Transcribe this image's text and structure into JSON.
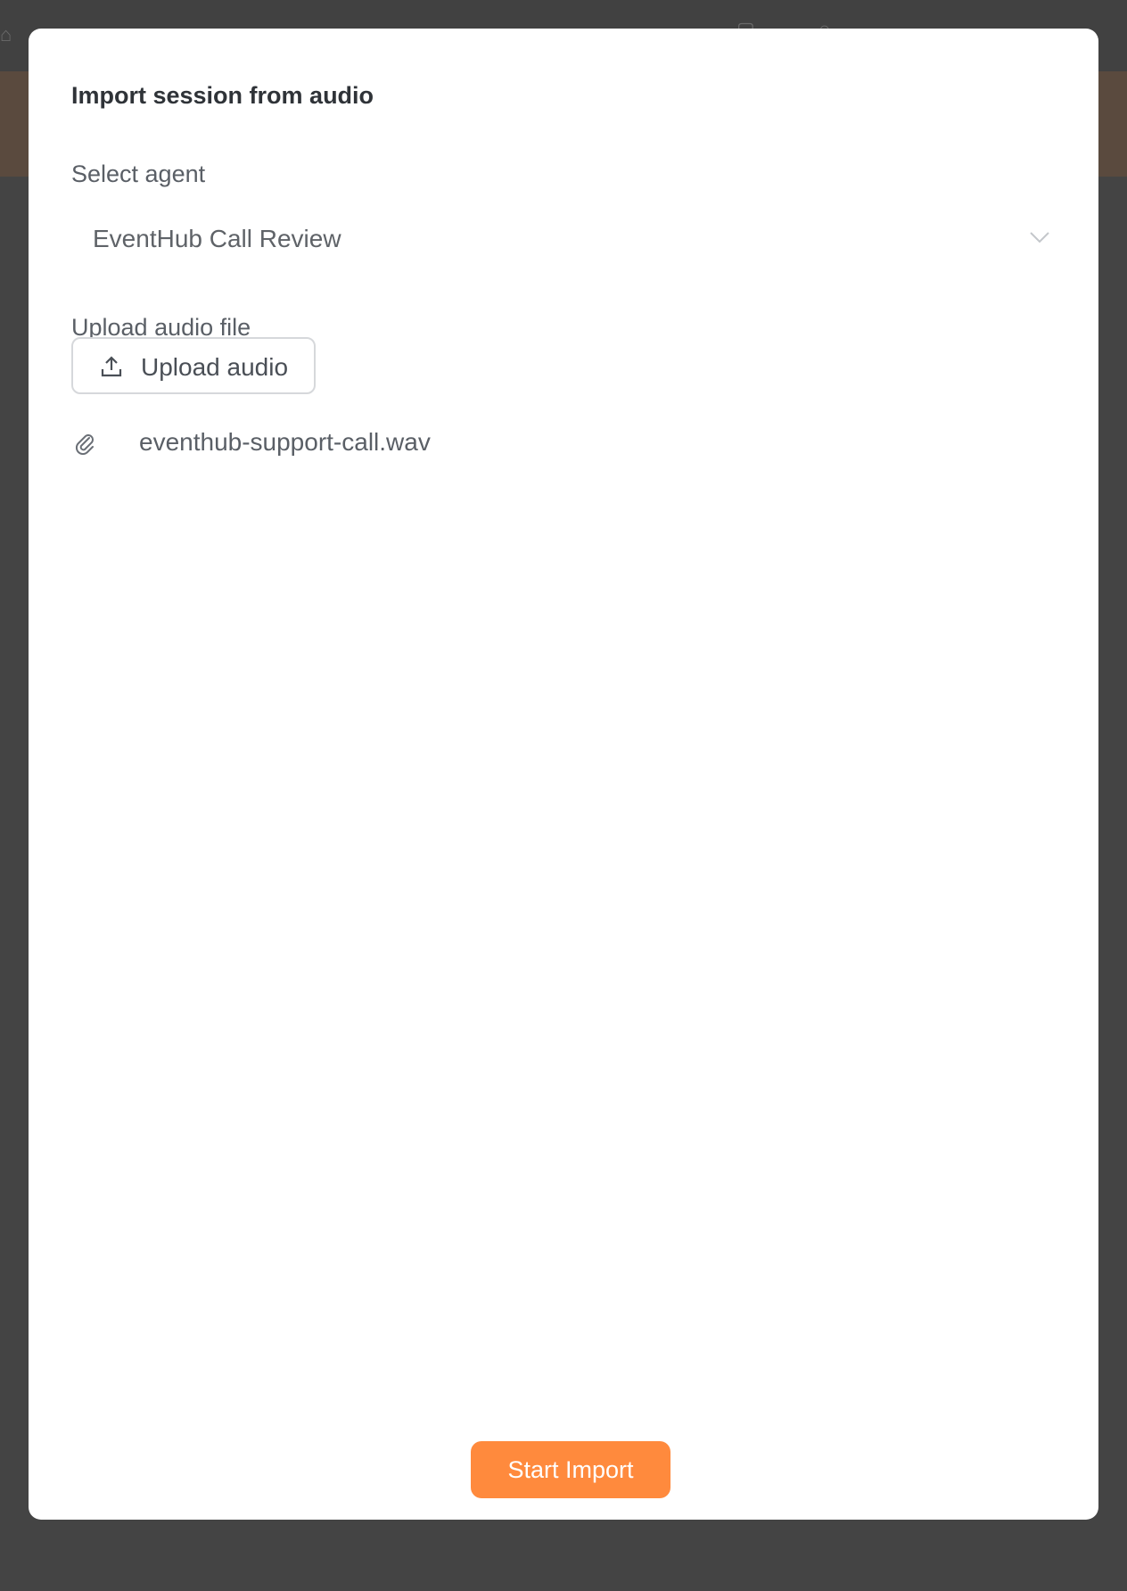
{
  "modal": {
    "title": "Import session from audio",
    "select_agent_label": "Select agent",
    "selected_agent": "EventHub Call Review",
    "upload_label": "Upload audio file",
    "upload_button_label": "Upload audio",
    "uploaded_file_name": "eventhub-support-call.wav",
    "start_button_label": "Start Import"
  },
  "icons": {
    "dropdown": "chevron-down-icon",
    "upload": "upload-icon",
    "attachment": "paperclip-icon"
  },
  "colors": {
    "primary": "#ff8a3d",
    "overlay": "#444444",
    "modal_background": "#ffffff"
  }
}
